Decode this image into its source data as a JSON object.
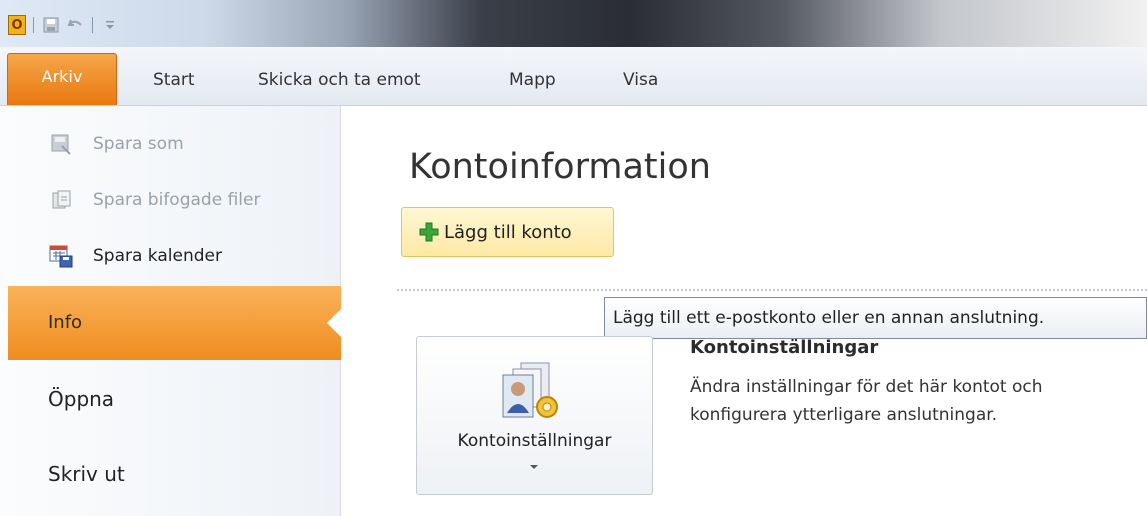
{
  "quick_access": {
    "app_icon_letter": "O",
    "icons": [
      "save-icon",
      "undo-icon",
      "customize-qat-icon"
    ]
  },
  "ribbon": {
    "tabs": [
      {
        "label": "Arkiv",
        "active": true
      },
      {
        "label": "Start"
      },
      {
        "label": "Skicka och ta emot"
      },
      {
        "label": "Mapp"
      },
      {
        "label": "Visa"
      }
    ]
  },
  "backstage": {
    "items": [
      {
        "label": "Spara som",
        "icon": "save-as-icon",
        "disabled": true
      },
      {
        "label": "Spara bifogade filer",
        "icon": "save-attachments-icon",
        "disabled": true
      },
      {
        "label": "Spara kalender",
        "icon": "save-calendar-icon",
        "disabled": false
      }
    ],
    "selected": "Info",
    "nav": [
      "Öppna",
      "Skriv ut"
    ]
  },
  "main": {
    "title": "Kontoinformation",
    "add_account_label": "Lägg till konto",
    "tooltip": "Lägg till ett e-postkonto eller en annan anslutning.",
    "account_settings": {
      "button_label": "Kontoinställningar",
      "heading": "Kontoinställningar",
      "description": "Ändra inställningar för det här kontot och konfigurera ytterligare anslutningar."
    }
  },
  "colors": {
    "accent_orange": "#f08c1e",
    "add_button_bg": "#fde9a5",
    "plus_green": "#3aa63a"
  }
}
